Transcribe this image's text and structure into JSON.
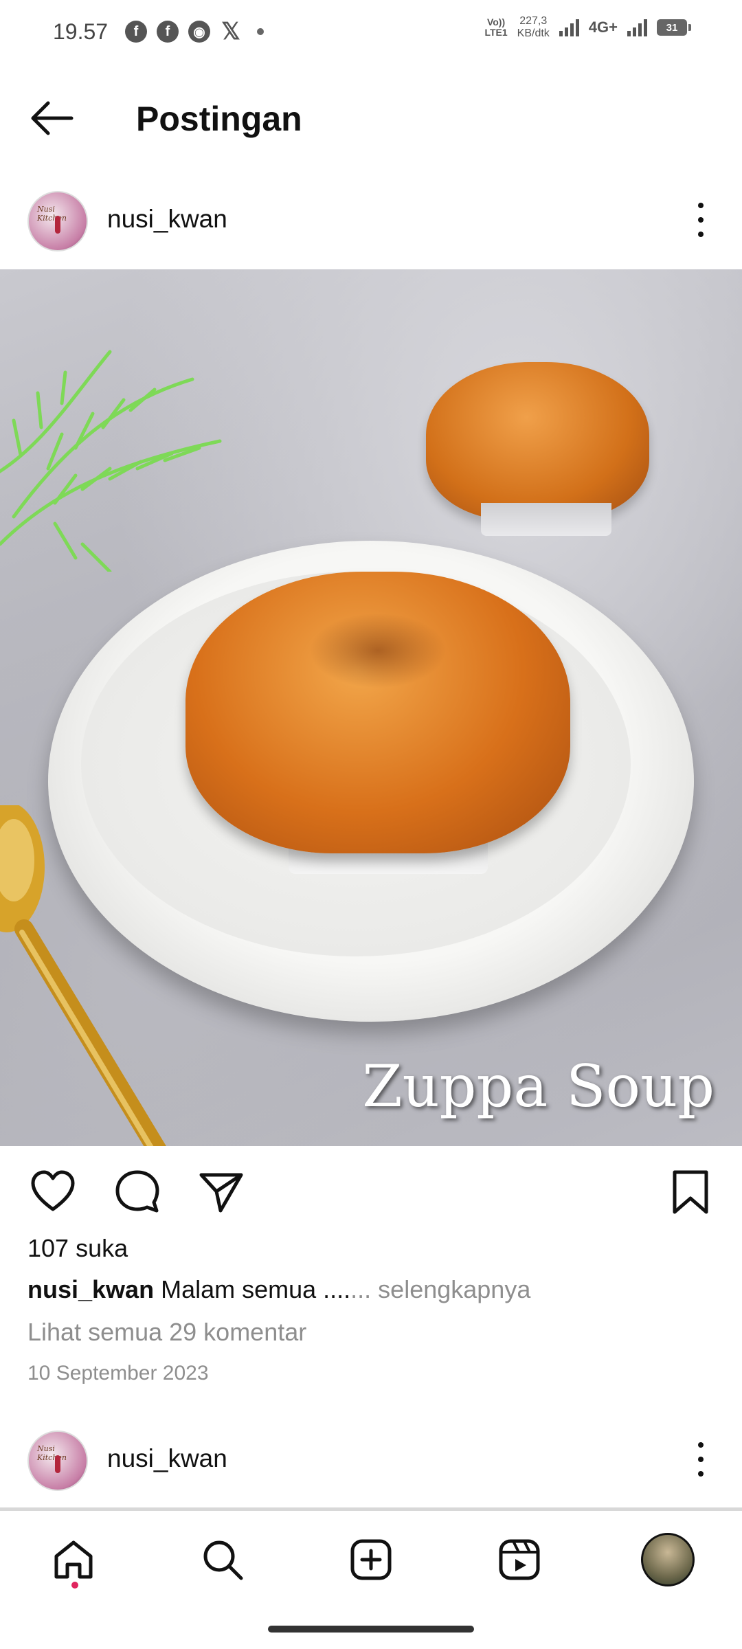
{
  "status_bar": {
    "time": "19.57",
    "notification_icons": [
      "facebook-icon",
      "facebook-icon",
      "compass-icon",
      "x-icon",
      "dot-icon"
    ],
    "volte": "Vo))\nLTE1",
    "speed": "227,3\nKB/dtk",
    "network": "4G+",
    "battery": "31"
  },
  "header": {
    "back_icon": "arrow-left-icon",
    "title": "Postingan"
  },
  "post": {
    "username": "nusi_kwan",
    "avatar_text": "Nusi Kitchen",
    "photo_caption": "Zuppa Soup",
    "likes": "107 suka",
    "caption_user": "nusi_kwan",
    "caption_text": "Malam semua ....",
    "caption_more": "... selengkapnya",
    "comments_link": "Lihat semua 29 komentar",
    "date": "10 September 2023"
  },
  "next_post": {
    "username": "nusi_kwan"
  },
  "actions": [
    "heart-icon",
    "comment-icon",
    "share-icon",
    "bookmark-icon"
  ],
  "bottom_nav": [
    "home-icon",
    "search-icon",
    "create-icon",
    "reels-icon",
    "profile-avatar"
  ],
  "colors": {
    "text": "#111111",
    "muted": "#8e8e8e",
    "notification_dot": "#e0245e"
  }
}
